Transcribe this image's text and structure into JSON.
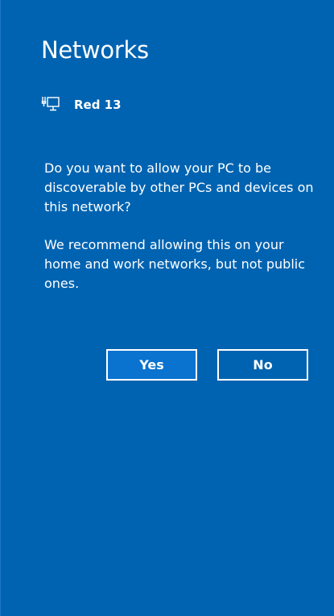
{
  "panel": {
    "title": "Networks",
    "network": {
      "icon": "ethernet-monitor-icon",
      "name": "Red 13"
    },
    "message_primary": "Do you want to allow your PC to be discoverable by other PCs and devices on this network?",
    "message_secondary": "We recommend allowing this on your home and work networks, but not public ones.",
    "buttons": {
      "yes_label": "Yes",
      "no_label": "No"
    },
    "colors": {
      "background": "#0063b1",
      "accent_button": "#0a72cf",
      "text": "#ffffff"
    }
  }
}
